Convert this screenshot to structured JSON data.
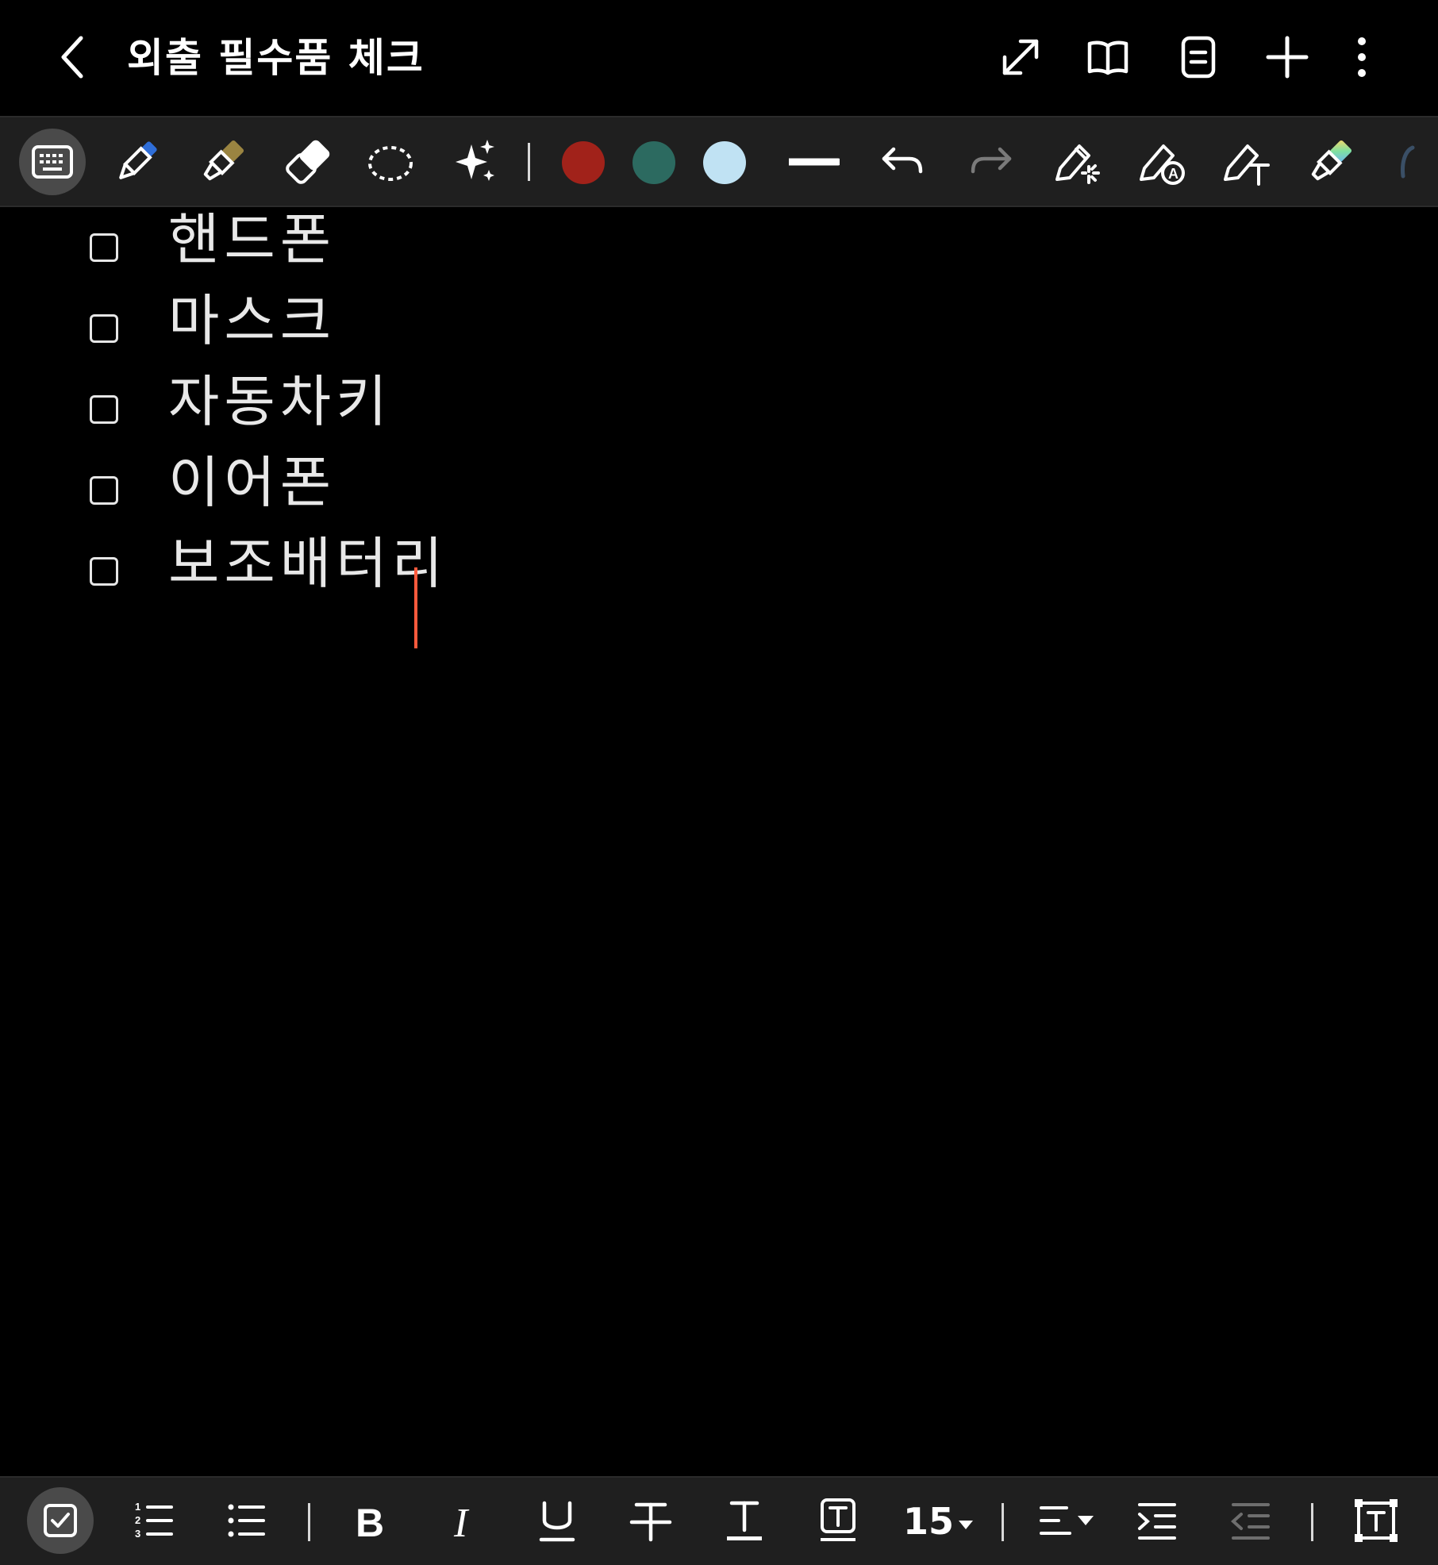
{
  "appbar": {
    "title": "외출 필수품 체크"
  },
  "pen_toolbar": {
    "colors": [
      "#a1221a",
      "#2c6a60",
      "#c0e2f3"
    ]
  },
  "checklist": [
    {
      "label": "핸드폰",
      "checked": false
    },
    {
      "label": "마스크",
      "checked": false
    },
    {
      "label": "자동차키",
      "checked": false
    },
    {
      "label": "이어폰",
      "checked": false
    },
    {
      "label": "보조배터리",
      "checked": false
    }
  ],
  "format_toolbar": {
    "font_size": "15"
  }
}
